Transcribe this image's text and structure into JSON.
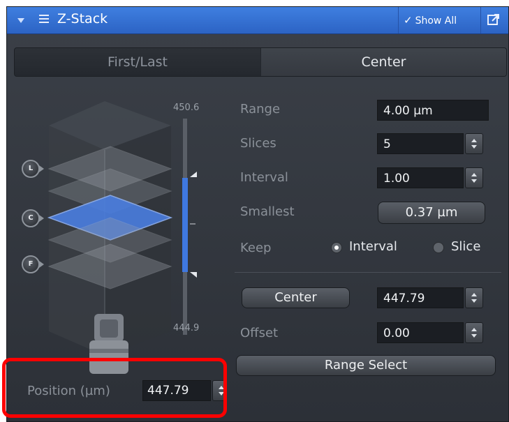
{
  "panel": {
    "title": "Z-Stack",
    "show_all_label": "Show All"
  },
  "tabs": [
    {
      "label": "First/Last",
      "active": false
    },
    {
      "label": "Center",
      "active": true
    }
  ],
  "scale": {
    "top": "450.6",
    "bottom": "444.9"
  },
  "markers": {
    "last": "L",
    "center": "C",
    "first": "F"
  },
  "form": {
    "range_label": "Range",
    "range_value": "4.00 µm",
    "slices_label": "Slices",
    "slices_value": "5",
    "interval_label": "Interval",
    "interval_value": "1.00",
    "smallest_label": "Smallest",
    "smallest_value": "0.37 µm",
    "keep_label": "Keep",
    "keep_interval": "Interval",
    "keep_slice": "Slice",
    "keep_selected": "Interval",
    "center_button": "Center",
    "center_value": "447.79",
    "offset_label": "Offset",
    "offset_value": "0.00",
    "range_select_button": "Range Select"
  },
  "position": {
    "label": "Position (µm)",
    "value": "447.79"
  },
  "colors": {
    "accent": "#2f6bd0",
    "highlight": "#ff0000",
    "active_slice": "#4a7ee0"
  }
}
